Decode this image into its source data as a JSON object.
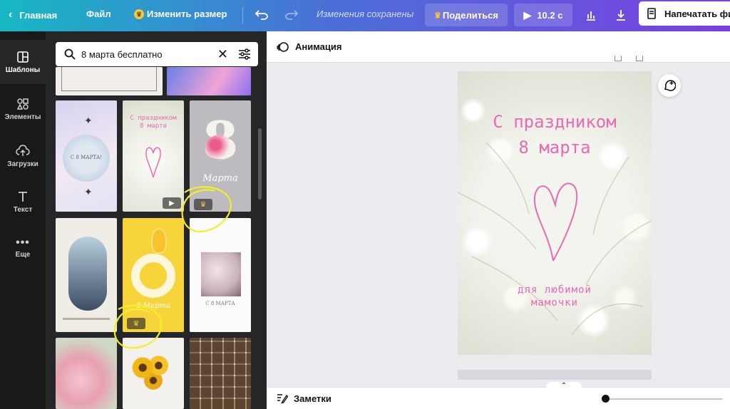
{
  "topbar": {
    "home_label": "Главная",
    "file_label": "Файл",
    "resize_label": "Изменить размер",
    "saved_label": "Изменения сохранены",
    "share_label": "Поделиться",
    "play_label": "10.2 с",
    "print_label": "Напечатать фи"
  },
  "rail": [
    {
      "label": "Шаблоны",
      "icon": "templates-icon"
    },
    {
      "label": "Элементы",
      "icon": "elements-icon"
    },
    {
      "label": "Загрузки",
      "icon": "uploads-icon"
    },
    {
      "label": "Текст",
      "icon": "text-icon"
    },
    {
      "label": "Еще",
      "icon": "more-icon"
    }
  ],
  "search": {
    "value": "8 марта бесплатно"
  },
  "toolbar": {
    "animation_label": "Анимация"
  },
  "card": {
    "title_line1": "С праздником",
    "title_line2": "8 марта",
    "sub_line1": "для любимой",
    "sub_line2": "мамочки"
  },
  "thumbs": {
    "t1_text": "С 8 МАРТА!",
    "t2_text": "С праздником 8 марта",
    "t3_num": "8",
    "t3_text": "Марта",
    "t5_text": "8 Марта",
    "t6_text": "С 8 МАРТА"
  },
  "bottombar": {
    "notes_label": "Заметки"
  },
  "colors": {
    "accent_pink": "#e66bb4",
    "highlight_yellow": "#f4ee2a",
    "crown": "#f5c542"
  }
}
